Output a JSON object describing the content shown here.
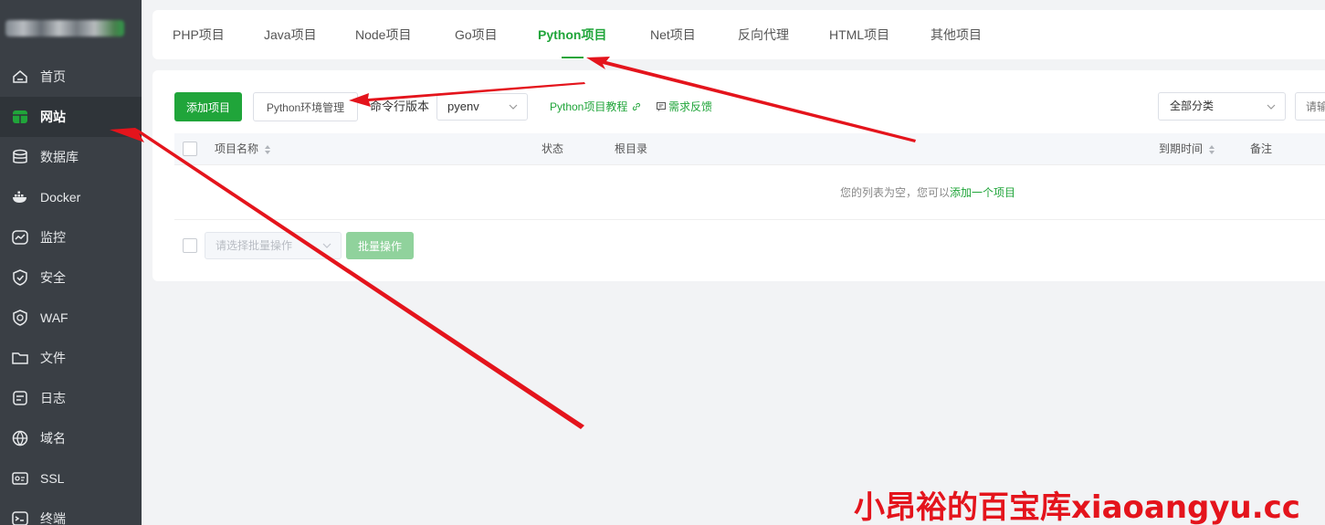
{
  "sidebar": {
    "items": [
      {
        "label": "首页",
        "icon": "home-icon"
      },
      {
        "label": "网站",
        "icon": "website-icon",
        "active": true
      },
      {
        "label": "数据库",
        "icon": "database-icon"
      },
      {
        "label": "Docker",
        "icon": "docker-icon"
      },
      {
        "label": "监控",
        "icon": "monitor-icon"
      },
      {
        "label": "安全",
        "icon": "shield-icon"
      },
      {
        "label": "WAF",
        "icon": "waf-icon"
      },
      {
        "label": "文件",
        "icon": "folder-icon"
      },
      {
        "label": "日志",
        "icon": "log-icon"
      },
      {
        "label": "域名",
        "icon": "globe-icon"
      },
      {
        "label": "SSL",
        "icon": "ssl-icon"
      },
      {
        "label": "终端",
        "icon": "terminal-icon"
      }
    ]
  },
  "tabs": [
    {
      "label": "PHP项目"
    },
    {
      "label": "Java项目"
    },
    {
      "label": "Node项目"
    },
    {
      "label": "Go项目"
    },
    {
      "label": "Python项目",
      "active": true
    },
    {
      "label": "Net项目"
    },
    {
      "label": "反向代理"
    },
    {
      "label": "HTML项目"
    },
    {
      "label": "其他项目"
    }
  ],
  "toolbar": {
    "add_label": "添加项目",
    "env_label": "Python环境管理",
    "cmd_label": "命令行版本",
    "cmd_value": "pyenv",
    "tutorial_label": "Python项目教程",
    "feedback_label": "需求反馈",
    "category_value": "全部分类",
    "search_placeholder": "请输"
  },
  "table": {
    "columns": {
      "name": "项目名称",
      "status": "状态",
      "root": "根目录",
      "expire": "到期时间",
      "remark": "备注"
    },
    "empty_text": "您的列表为空，您可以",
    "empty_link": "添加一个项目"
  },
  "batch": {
    "select_placeholder": "请选择批量操作",
    "button_label": "批量操作"
  },
  "watermark": "小昂裕的百宝库xiaoangyu.cc",
  "colors": {
    "accent": "#20a53a",
    "sidebar": "#3a3f45",
    "annotation": "#e4141c"
  }
}
